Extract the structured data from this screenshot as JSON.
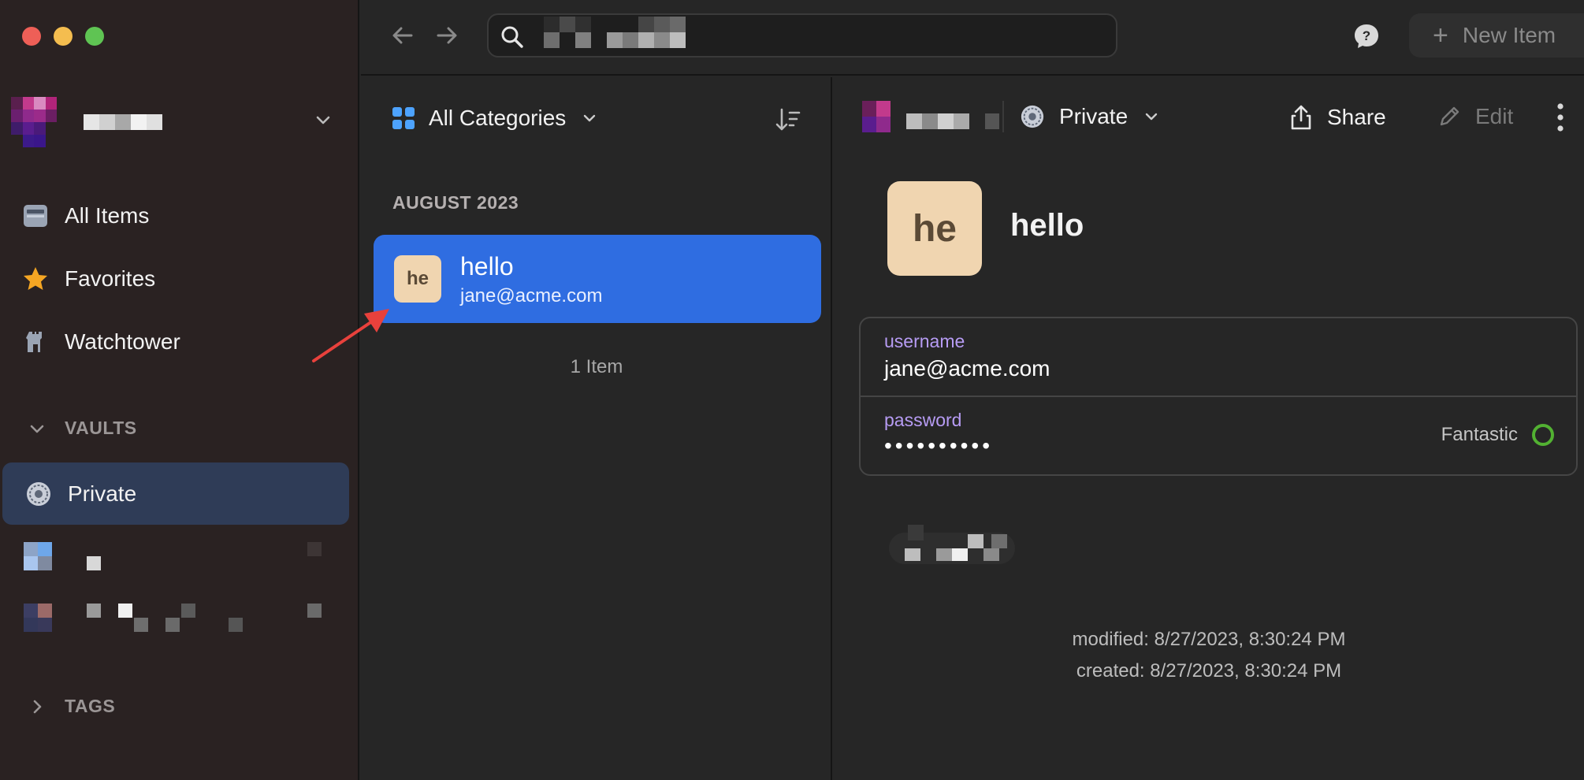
{
  "window": {
    "controls": [
      "close",
      "minimize",
      "zoom"
    ]
  },
  "sidebar": {
    "nav": [
      {
        "label": "All Items",
        "icon": "all-items-icon"
      },
      {
        "label": "Favorites",
        "icon": "star-icon"
      },
      {
        "label": "Watchtower",
        "icon": "watchtower-icon"
      }
    ],
    "vaults_heading": "VAULTS",
    "vaults": [
      {
        "label": "Private",
        "icon": "vault-icon",
        "selected": true
      }
    ],
    "tags_heading": "TAGS"
  },
  "toolbar": {
    "new_item_label": "New Item"
  },
  "list": {
    "category_label": "All Categories",
    "month_heading": "AUGUST 2023",
    "items": [
      {
        "thumb": "he",
        "title": "hello",
        "subtitle": "jane@acme.com",
        "selected": true
      }
    ],
    "count_label": "1 Item"
  },
  "detail": {
    "vault_label": "Private",
    "share_label": "Share",
    "edit_label": "Edit",
    "thumb": "he",
    "title": "hello",
    "fields": {
      "username_label": "username",
      "username_value": "jane@acme.com",
      "password_label": "password",
      "password_value": "••••••••••",
      "strength_label": "Fantastic"
    },
    "modified": "modified: 8/27/2023, 8:30:24 PM",
    "created": "created: 8/27/2023, 8:30:24 PM"
  },
  "colors": {
    "accent_blue": "#2f6de1",
    "vault_selected": "#2f3c57",
    "label_purple": "#b79cf4",
    "strength_green": "#52b132",
    "annotation_red": "#e8413c"
  }
}
